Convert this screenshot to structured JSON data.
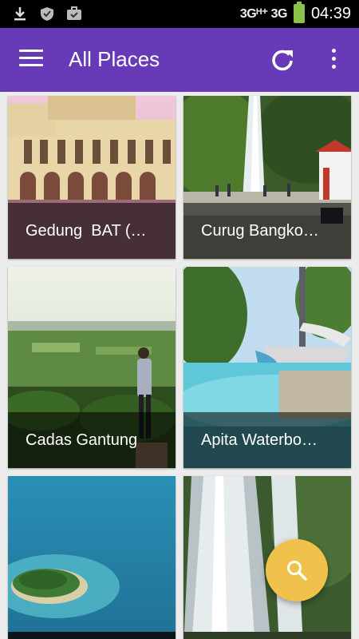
{
  "status_bar": {
    "network": "3Gᴴ⁺ 3G",
    "time": "04:39",
    "icons": [
      "download-icon",
      "shield-icon",
      "briefcase-icon"
    ]
  },
  "app_bar": {
    "title": "All Places",
    "icons": [
      "menu-icon",
      "refresh-icon",
      "more-vert-icon"
    ]
  },
  "places": [
    {
      "name": "Gedung  BAT (…"
    },
    {
      "name": "Curug Bangko…"
    },
    {
      "name": "Cadas Gantung"
    },
    {
      "name": "Apita Waterbo…"
    },
    {
      "name": ""
    },
    {
      "name": ""
    }
  ],
  "fab": {
    "icon": "search-icon"
  },
  "colors": {
    "primary": "#673ab7",
    "fab": "#f0c24b",
    "caption_overlay": "rgba(0,0,0,0.55)"
  }
}
